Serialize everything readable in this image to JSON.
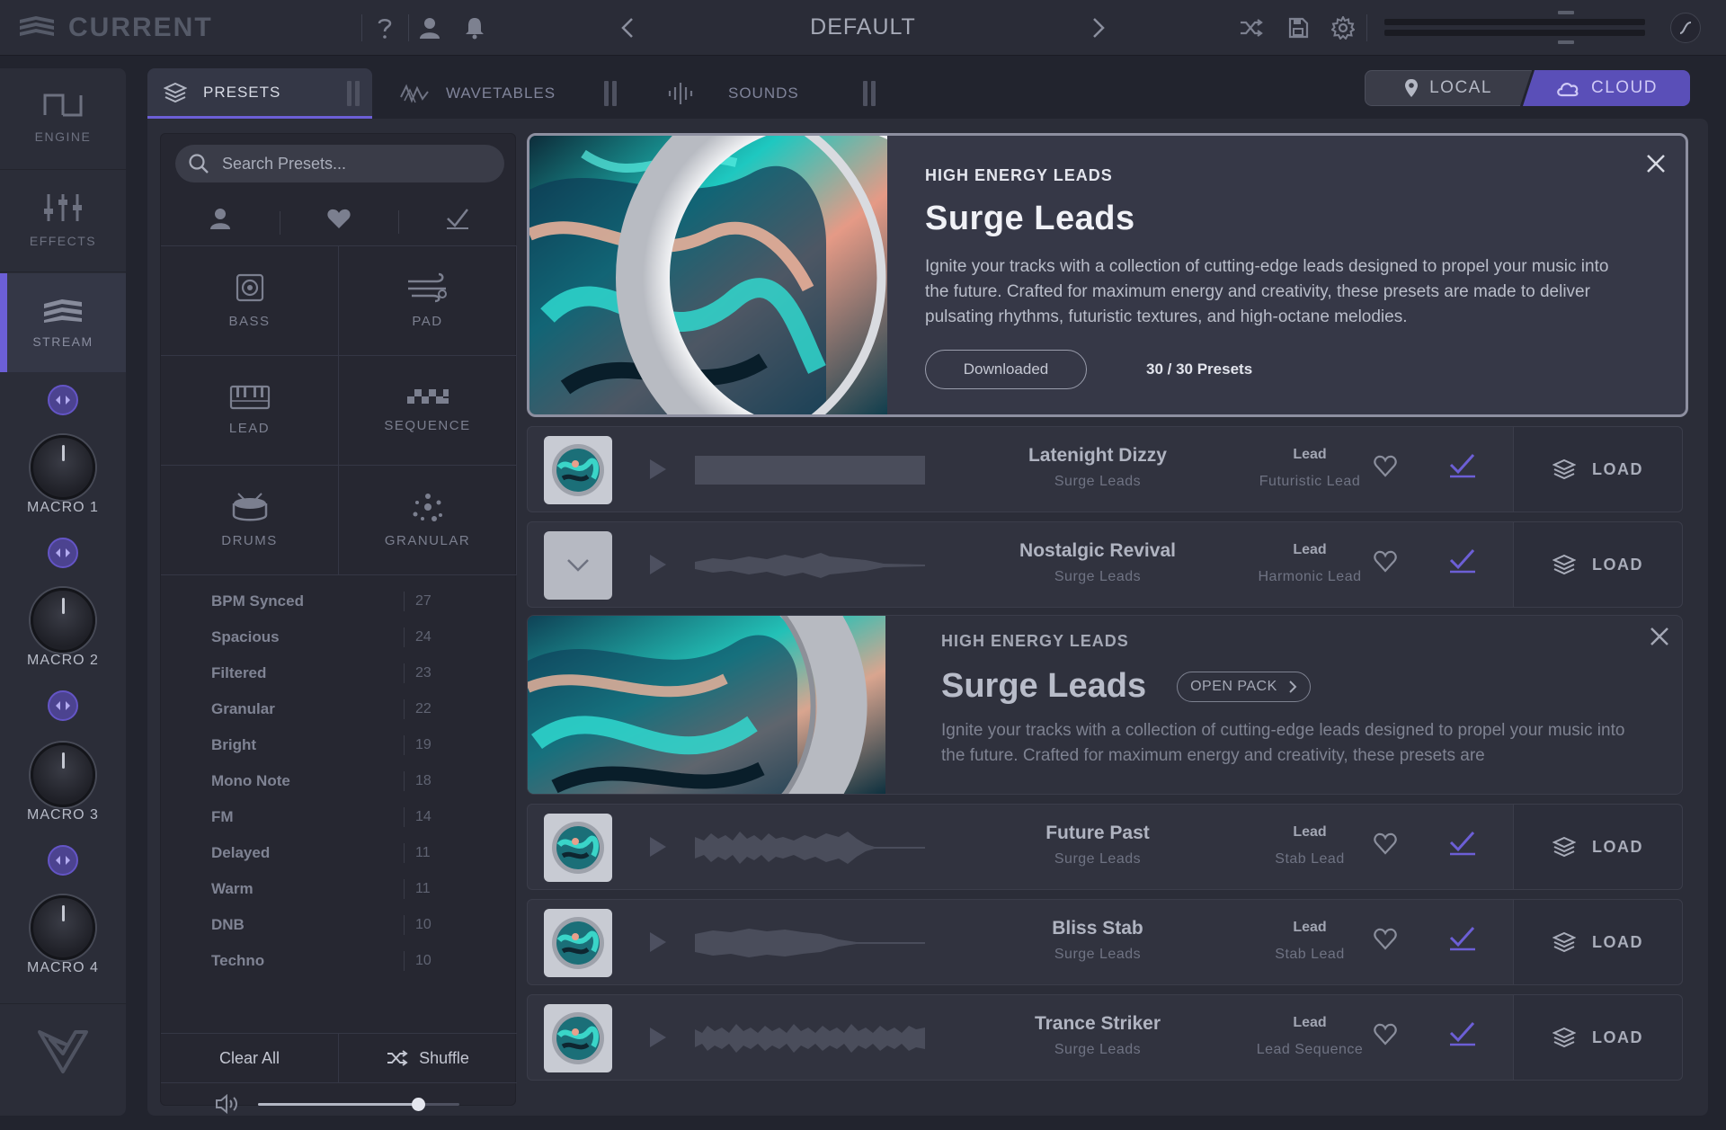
{
  "app": {
    "name": "CURRENT",
    "preset_name": "DEFAULT"
  },
  "nav": {
    "items": [
      {
        "label": "ENGINE"
      },
      {
        "label": "EFFECTS"
      },
      {
        "label": "STREAM"
      }
    ],
    "macros": [
      {
        "label": "MACRO 1"
      },
      {
        "label": "MACRO 2"
      },
      {
        "label": "MACRO 3"
      },
      {
        "label": "MACRO 4"
      }
    ]
  },
  "tabs": [
    {
      "label": "PRESETS",
      "active": true
    },
    {
      "label": "WAVETABLES",
      "active": false
    },
    {
      "label": "SOUNDS",
      "active": false
    }
  ],
  "source": {
    "local": "LOCAL",
    "cloud": "CLOUD",
    "selected": "CLOUD"
  },
  "browser": {
    "search_placeholder": "Search Presets...",
    "categories": [
      {
        "label": "BASS"
      },
      {
        "label": "PAD"
      },
      {
        "label": "LEAD"
      },
      {
        "label": "SEQUENCE"
      },
      {
        "label": "DRUMS"
      },
      {
        "label": "GRANULAR"
      }
    ],
    "tags": [
      {
        "name": "BPM Synced",
        "count": "27"
      },
      {
        "name": "Spacious",
        "count": "24"
      },
      {
        "name": "Filtered",
        "count": "23"
      },
      {
        "name": "Granular",
        "count": "22"
      },
      {
        "name": "Bright",
        "count": "19"
      },
      {
        "name": "Mono Note",
        "count": "18"
      },
      {
        "name": "FM",
        "count": "14"
      },
      {
        "name": "Delayed",
        "count": "11"
      },
      {
        "name": "Warm",
        "count": "11"
      },
      {
        "name": "DNB",
        "count": "10"
      },
      {
        "name": "Techno",
        "count": "10"
      }
    ],
    "clear_all": "Clear All",
    "shuffle": "Shuffle",
    "volume": 0.8
  },
  "pack_expanded": {
    "subtitle": "HIGH ENERGY LEADS",
    "title": "Surge Leads",
    "description": "Ignite your tracks with a collection of cutting-edge leads designed to propel your music into the future. Crafted for maximum energy and creativity, these presets are made to deliver pulsating rhythms, futuristic textures, and high-octane melodies.",
    "button": "Downloaded",
    "count": "30 / 30 Presets"
  },
  "pack_collapsed": {
    "subtitle": "HIGH ENERGY LEADS",
    "title": "Surge Leads",
    "open_pack": "OPEN PACK",
    "description": "Ignite your tracks with a collection of cutting-edge leads designed to propel your music into the future. Crafted for maximum energy and creativity, these presets are"
  },
  "presets": [
    {
      "name": "Latenight Dizzy",
      "pack": "Surge Leads",
      "category": "Lead",
      "type": "Futuristic Lead",
      "load": "LOAD"
    },
    {
      "name": "Nostalgic Revival",
      "pack": "Surge Leads",
      "category": "Lead",
      "type": "Harmonic Lead",
      "load": "LOAD"
    },
    {
      "name": "Future Past",
      "pack": "Surge Leads",
      "category": "Lead",
      "type": "Stab Lead",
      "load": "LOAD"
    },
    {
      "name": "Bliss Stab",
      "pack": "Surge Leads",
      "category": "Lead",
      "type": "Stab Lead",
      "load": "LOAD"
    },
    {
      "name": "Trance Striker",
      "pack": "Surge Leads",
      "category": "Lead",
      "type": "Lead Sequence",
      "load": "LOAD"
    }
  ],
  "colors": {
    "accent": "#6c5fd6",
    "check": "#6c5fd6",
    "background": "#22242e"
  }
}
